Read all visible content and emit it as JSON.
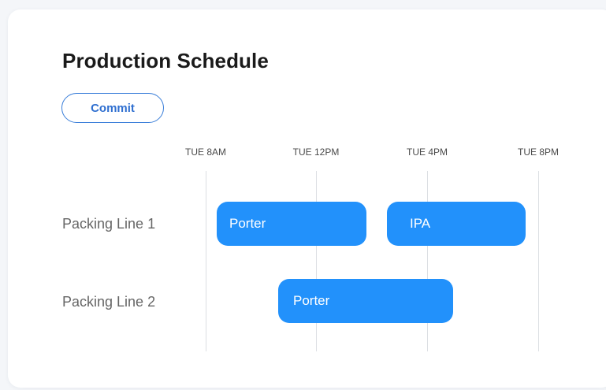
{
  "schedule": {
    "title": "Production Schedule",
    "commit_label": "Commit",
    "time_labels": [
      "TUE 8AM",
      "TUE 12PM",
      "TUE 4PM",
      "TUE 8PM"
    ],
    "rows": [
      {
        "label": "Packing Line 1",
        "jobs": [
          {
            "label": "Porter"
          },
          {
            "label": "IPA"
          }
        ]
      },
      {
        "label": "Packing Line 2",
        "jobs": [
          {
            "label": "Porter"
          }
        ]
      }
    ],
    "colors": {
      "accent": "#2291fb",
      "commit_border": "#3b7fd9",
      "commit_text": "#2f6fd0",
      "grid": "#dcdfe3"
    }
  }
}
